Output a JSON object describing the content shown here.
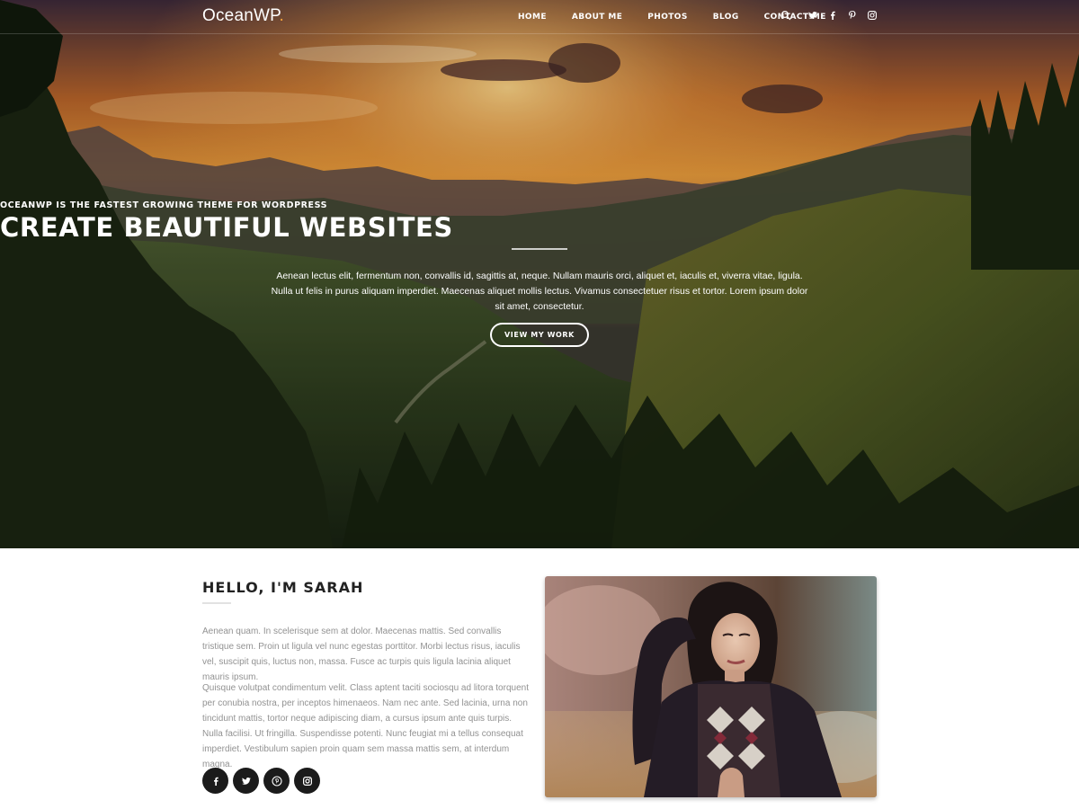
{
  "header": {
    "logo_text": "OceanWP",
    "logo_dot": ".",
    "nav": [
      "HOME",
      "ABOUT ME",
      "PHOTOS",
      "BLOG",
      "CONTACT ME"
    ],
    "icons": [
      "search-icon",
      "twitter-icon",
      "facebook-icon",
      "pinterest-icon",
      "instagram-icon"
    ]
  },
  "hero": {
    "kicker": "OCEANWP IS THE FASTEST GROWING THEME FOR WORDPRESS",
    "title": "CREATE BEAUTIFUL WEBSITES",
    "text": "Aenean lectus elit, fermentum non, convallis id, sagittis at, neque. Nullam mauris orci, aliquet et, iaculis et, viverra vitae, ligula. Nulla ut felis in purus aliquam imperdiet. Maecenas aliquet mollis lectus. Vivamus consectetuer risus et tortor. Lorem ipsum dolor sit amet, consectetur.",
    "button_label": "VIEW MY WORK"
  },
  "about": {
    "title": "HELLO, I'M SARAH",
    "paragraph1": "Aenean quam. In scelerisque sem at dolor. Maecenas mattis. Sed convallis tristique sem. Proin ut ligula vel nunc egestas porttitor. Morbi lectus risus, iaculis vel, suscipit quis, luctus non, massa. Fusce ac turpis quis ligula lacinia aliquet mauris ipsum.",
    "paragraph2": "Quisque volutpat condimentum velit. Class aptent taciti sociosqu ad litora torquent per conubia nostra, per inceptos himenaeos. Nam nec ante. Sed lacinia, urna non tincidunt mattis, tortor neque adipiscing diam, a cursus ipsum ante quis turpis. Nulla facilisi. Ut fringilla. Suspendisse potenti. Nunc feugiat mi a tellus consequat imperdiet. Vestibulum sapien proin quam sem massa mattis sem, at interdum magna.",
    "socials": [
      "facebook-icon",
      "twitter-icon",
      "pinterest-icon",
      "instagram-icon"
    ]
  },
  "colors": {
    "accent": "#f2a23b",
    "dark_button": "#1b1b1b",
    "body_text": "#929292",
    "heading": "#222222"
  }
}
